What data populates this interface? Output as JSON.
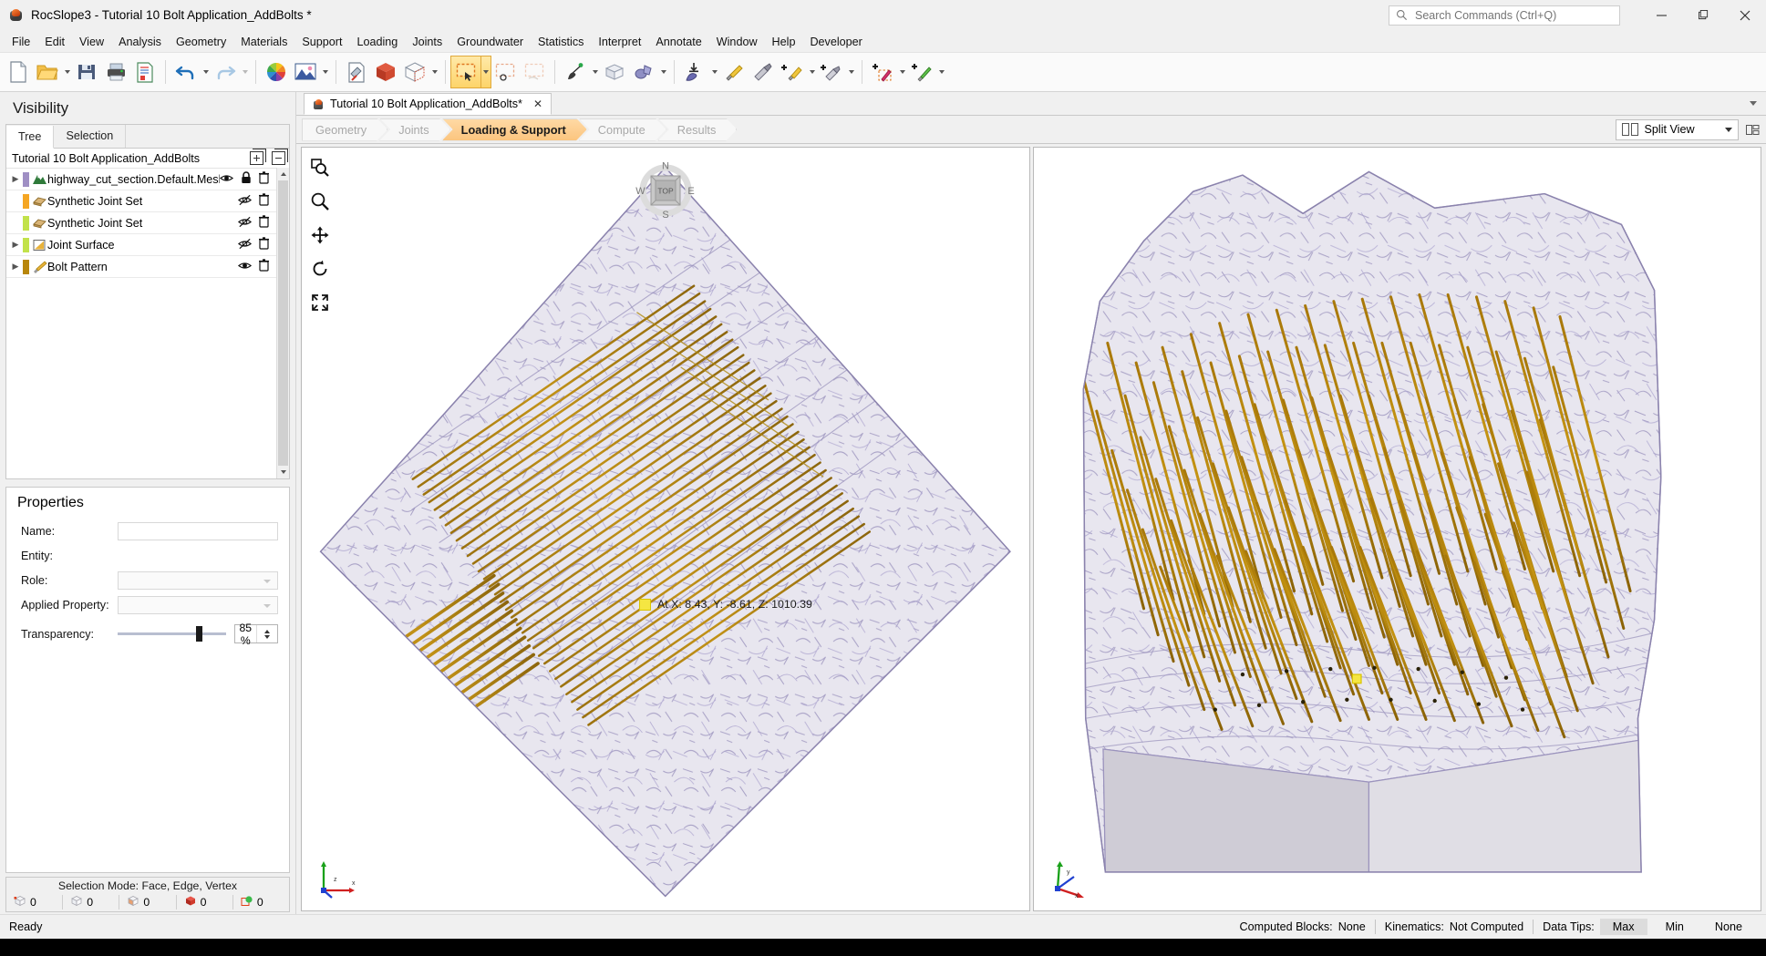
{
  "window": {
    "title": "RocSlope3 - Tutorial 10 Bolt Application_AddBolts *",
    "app_icon": "rocslope-icon",
    "minimize_label": "—",
    "maximize_label": "❐",
    "close_label": "✕"
  },
  "search": {
    "placeholder": "Search Commands (Ctrl+Q)",
    "value": "",
    "icon": "search-icon"
  },
  "menu": {
    "items": [
      "File",
      "Edit",
      "View",
      "Analysis",
      "Geometry",
      "Materials",
      "Support",
      "Loading",
      "Joints",
      "Groundwater",
      "Statistics",
      "Interpret",
      "Annotate",
      "Window",
      "Help",
      "Developer"
    ]
  },
  "toolbar": {
    "groups": [
      {
        "buttons": [
          {
            "name": "new-file-button",
            "icon": "new-document-icon",
            "caret": false,
            "active": false
          },
          {
            "name": "open-file-button",
            "icon": "open-folder-icon",
            "caret": true,
            "active": false
          },
          {
            "name": "save-button",
            "icon": "floppy-save-icon",
            "caret": false,
            "active": false
          },
          {
            "name": "print-button",
            "icon": "printer-icon",
            "caret": false,
            "active": false
          },
          {
            "name": "report-button",
            "icon": "report-document-icon",
            "caret": false,
            "active": false
          }
        ]
      },
      {
        "buttons": [
          {
            "name": "undo-button",
            "icon": "undo-arrow-icon",
            "caret": true,
            "active": false
          },
          {
            "name": "redo-button",
            "icon": "redo-arrow-icon",
            "caret": true,
            "active": false,
            "disabled": true
          }
        ]
      },
      {
        "buttons": [
          {
            "name": "color-palette-button",
            "icon": "color-wheel-icon",
            "caret": false,
            "active": false
          },
          {
            "name": "image-capture-button",
            "icon": "picture-icon",
            "caret": true,
            "active": false
          }
        ]
      },
      {
        "buttons": [
          {
            "name": "geometry-tools-button",
            "icon": "document-tools-icon",
            "caret": false,
            "active": false
          },
          {
            "name": "solid-model-button",
            "icon": "red-cube-icon",
            "caret": false,
            "active": false
          },
          {
            "name": "mesh-view-button",
            "icon": "wireframe-cube-icon",
            "caret": true,
            "active": false
          }
        ]
      },
      {
        "buttons": [
          {
            "name": "rectangle-select-button",
            "icon": "rectangle-select-icon",
            "caret": true,
            "active": true
          },
          {
            "name": "circle-select-button",
            "icon": "circle-select-icon",
            "caret": false,
            "active": false,
            "disabled": true
          },
          {
            "name": "freehand-select-button",
            "icon": "freehand-select-icon",
            "caret": false,
            "active": false,
            "disabled": true
          }
        ]
      },
      {
        "buttons": [
          {
            "name": "pin-probe-button",
            "icon": "probe-pin-icon",
            "caret": true,
            "active": false
          },
          {
            "name": "block-view-button",
            "icon": "open-box-icon",
            "caret": false,
            "active": false
          },
          {
            "name": "joint-blobs-button",
            "icon": "joint-blobs-icon",
            "caret": true,
            "active": false
          }
        ]
      },
      {
        "buttons": [
          {
            "name": "import-support-button",
            "icon": "import-support-icon",
            "caret": true,
            "active": false
          },
          {
            "name": "add-bolt-button",
            "icon": "bolt-pencil-icon",
            "caret": false,
            "active": false
          },
          {
            "name": "bolt-surface-button",
            "icon": "bolt-surface-icon",
            "caret": false,
            "active": false
          },
          {
            "name": "add-bolt-plus-button",
            "icon": "plus-bolt-icon",
            "caret": true,
            "active": false
          },
          {
            "name": "add-surface-plus-button",
            "icon": "plus-surface-icon",
            "caret": true,
            "active": false
          },
          {
            "name": "add-pattern-button",
            "icon": "plus-pattern-icon",
            "caret": true,
            "active": false
          },
          {
            "name": "add-green-bolt-button",
            "icon": "plus-green-bolt-icon",
            "caret": true,
            "active": false
          }
        ]
      }
    ]
  },
  "visibility": {
    "panel_title": "Visibility",
    "tabs": [
      {
        "label": "Tree",
        "selected": true
      },
      {
        "label": "Selection",
        "selected": false
      }
    ],
    "tree_root_label": "Tutorial 10 Bolt Application_AddBolts",
    "expand_all_tooltip": "Expand All",
    "collapse_all_tooltip": "Collapse All",
    "rows": [
      {
        "label": "highway_cut_section.Default.Mesh_",
        "icon": "terrain-mesh-icon",
        "color": "#9f8fc4",
        "has_twisty": true,
        "visible": true,
        "locked": true,
        "eye_icon": "eye-visible-icon",
        "lock_icon": "lock-closed-icon",
        "delete_icon": "trash-icon"
      },
      {
        "label": "Synthetic Joint Set",
        "icon": "joint-set-icon",
        "color": "#f5a623",
        "has_twisty": false,
        "visible": false,
        "locked": false,
        "eye_icon": "eye-hidden-icon",
        "delete_icon": "trash-icon"
      },
      {
        "label": "Synthetic Joint Set",
        "icon": "joint-set-icon",
        "color": "#c2e24a",
        "has_twisty": false,
        "visible": false,
        "locked": false,
        "eye_icon": "eye-hidden-icon",
        "delete_icon": "trash-icon"
      },
      {
        "label": "Joint Surface",
        "icon": "joint-surface-icon",
        "color": "#c2e24a",
        "has_twisty": true,
        "visible": false,
        "locked": false,
        "eye_icon": "eye-hidden-icon",
        "delete_icon": "trash-icon"
      },
      {
        "label": "Bolt Pattern",
        "icon": "bolt-pattern-icon",
        "color": "#b8860b",
        "has_twisty": true,
        "visible": true,
        "locked": false,
        "eye_icon": "eye-visible-icon",
        "delete_icon": "trash-icon"
      }
    ]
  },
  "properties": {
    "panel_title": "Properties",
    "fields": [
      {
        "label": "Name:",
        "value": "",
        "type": "text",
        "name": "name-field"
      },
      {
        "label": "Entity:",
        "value": "",
        "type": "static",
        "name": "entity-value"
      },
      {
        "label": "Role:",
        "value": "",
        "type": "combo",
        "name": "role-combo"
      },
      {
        "label": "Applied Property:",
        "value": "",
        "type": "combo",
        "name": "applied-property-combo"
      }
    ],
    "transparency": {
      "label": "Transparency:",
      "value": "85 %",
      "percent": 85
    }
  },
  "selection_status": {
    "mode_label": "Selection Mode:",
    "mode_value": "Face, Edge, Vertex",
    "counts": [
      {
        "icon": "vertex-count-icon",
        "value": "0"
      },
      {
        "icon": "edge-count-icon",
        "value": "0"
      },
      {
        "icon": "face-count-icon",
        "value": "0"
      },
      {
        "icon": "block-count-icon",
        "value": "0"
      },
      {
        "icon": "group-count-icon",
        "value": "0"
      }
    ]
  },
  "document": {
    "tab_label": "Tutorial 10 Bolt Application_AddBolts*",
    "tab_icon": "rocslope-doc-icon",
    "close_label": "✕",
    "collapse_icon": "chevron-down-icon"
  },
  "workflow": {
    "steps": [
      {
        "label": "Geometry",
        "active": false
      },
      {
        "label": "Joints",
        "active": false
      },
      {
        "label": "Loading & Support",
        "active": true
      },
      {
        "label": "Compute",
        "active": false
      },
      {
        "label": "Results",
        "active": false
      }
    ]
  },
  "view_controls": {
    "split_view_label": "Split View",
    "split_view_icon": "split-view-icon",
    "caret_icon": "chevron-down-icon",
    "layout_icon": "view-layout-icon",
    "tools": [
      {
        "name": "zoom-window-tool",
        "icon": "zoom-window-icon"
      },
      {
        "name": "zoom-tool",
        "icon": "magnifier-icon"
      },
      {
        "name": "pan-tool",
        "icon": "pan-arrows-icon"
      },
      {
        "name": "rotate-tool",
        "icon": "rotate-ccw-icon"
      },
      {
        "name": "zoom-all-tool",
        "icon": "zoom-all-icon"
      }
    ],
    "compass": {
      "north": "N",
      "east": "E",
      "south": "S",
      "west": "W",
      "face": "TOP"
    },
    "axes": {
      "x": "x",
      "y": "y",
      "z": "z"
    }
  },
  "datatip": {
    "text": "At X: 8.43, Y: -8.61, Z: 1010.39",
    "marker_color": "#f5e642"
  },
  "statusbar": {
    "ready_text": "Ready",
    "computed_blocks_label": "Computed Blocks:",
    "computed_blocks_value": "None",
    "kinematics_label": "Kinematics:",
    "kinematics_value": "Not Computed",
    "data_tips_label": "Data Tips:",
    "data_tip_options": [
      {
        "label": "Max",
        "selected": true
      },
      {
        "label": "Min",
        "selected": false
      },
      {
        "label": "None",
        "selected": false
      }
    ]
  },
  "colors": {
    "accent_orange": "#fbc57f",
    "bolt_gold": "#b8860b",
    "rock_fill": "#e6e4ee",
    "rock_edge": "#9b93bd",
    "chrome": "#f0f0f0"
  }
}
